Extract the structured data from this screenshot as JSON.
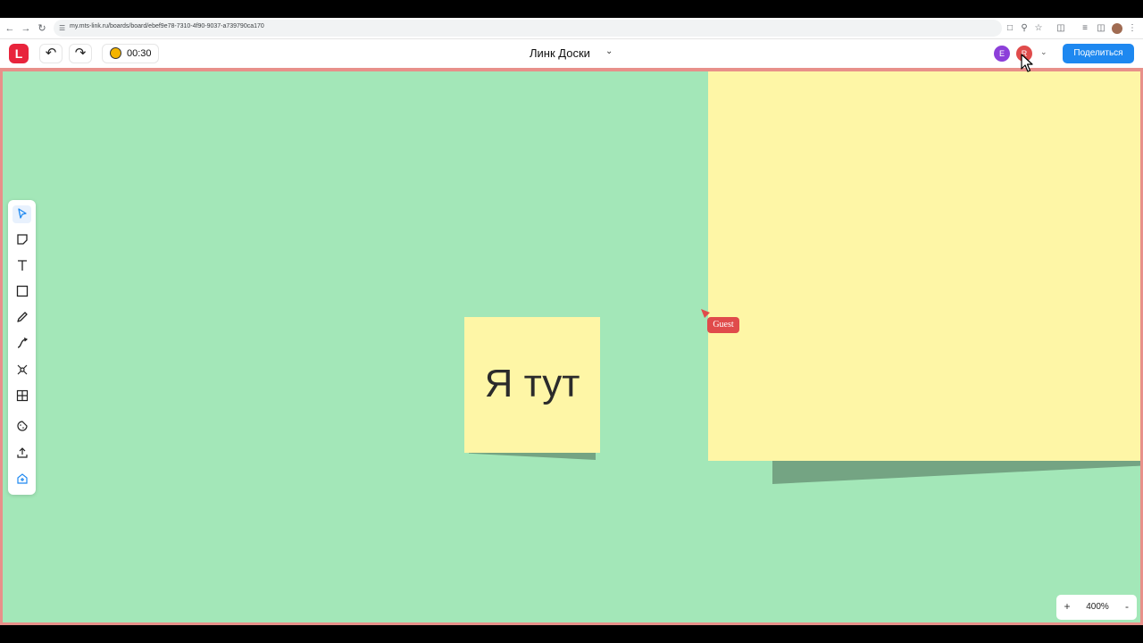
{
  "browser": {
    "url": "my.mts-link.ru/boards/board/ebef9e78-7310-4f90-9037-a739790ca170"
  },
  "header": {
    "timer": "00:30",
    "board_title": "Линк Доски",
    "avatars": [
      {
        "letter": "E",
        "color": "#8c3fd9"
      },
      {
        "letter": "R",
        "color": "#e04b4b"
      }
    ],
    "share_label": "Поделиться"
  },
  "canvas": {
    "background_color": "#a3e7b8",
    "note_color": "#fef6a6",
    "small_note_text": "Я тут",
    "guest_label": "Guest"
  },
  "toolbar": {
    "tools": [
      "select-icon",
      "sticky-note-icon",
      "text-icon",
      "shape-icon",
      "pen-icon",
      "connector-icon",
      "mindmap-icon",
      "table-icon",
      "stickers-icon",
      "upload-icon",
      "templates-icon"
    ]
  },
  "zoom": {
    "plus": "+",
    "value": "400%",
    "minus": "-"
  }
}
